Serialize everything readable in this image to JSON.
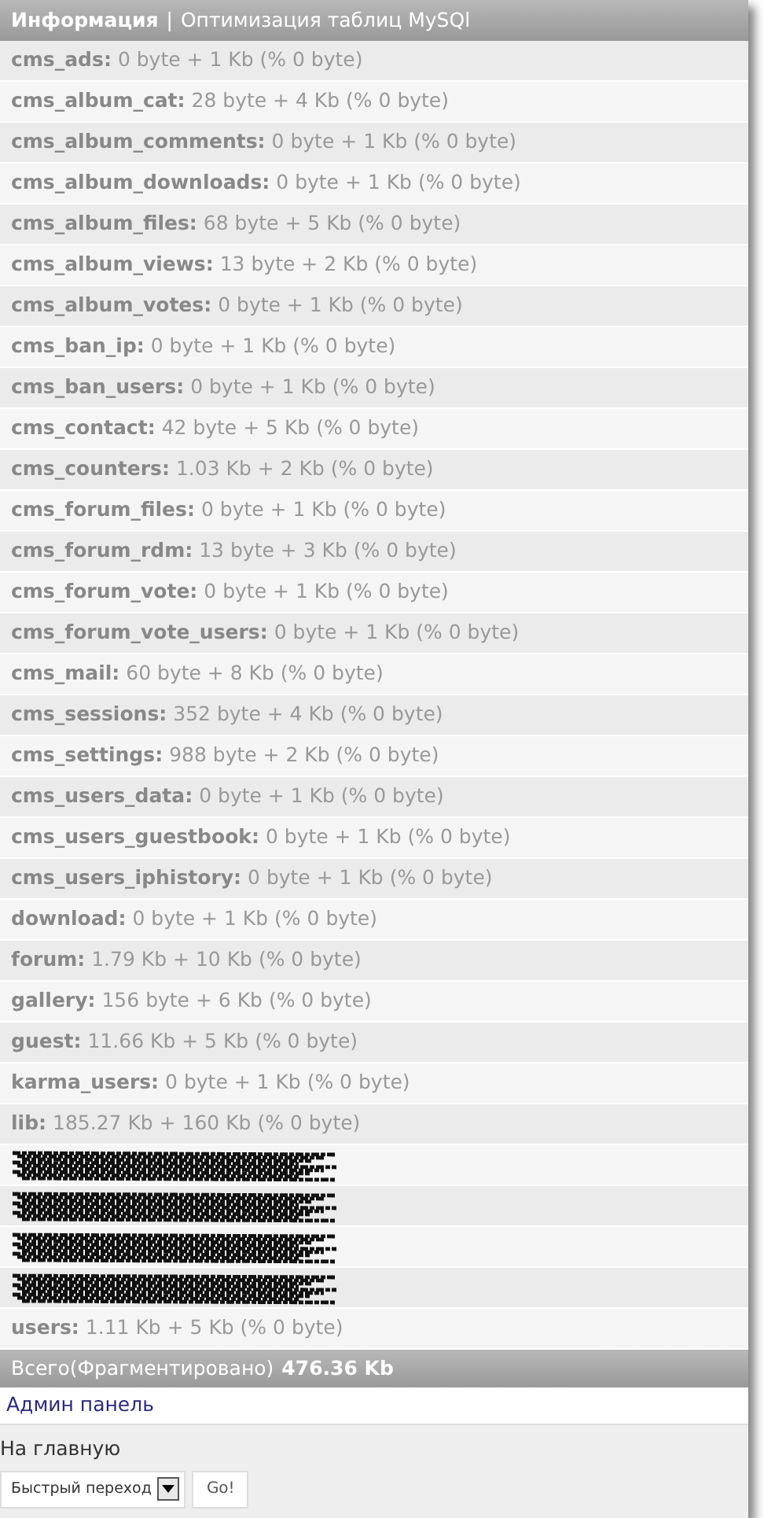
{
  "header": {
    "title": "Информация",
    "separator": "|",
    "subtitle": "Оптимизация таблиц MySQl"
  },
  "rows": [
    {
      "kind": "stat",
      "name": "cms_ads:",
      "value": "0 byte + 1 Kb (% 0 byte)"
    },
    {
      "kind": "stat",
      "name": "cms_album_cat:",
      "value": "28 byte + 4 Kb (% 0 byte)"
    },
    {
      "kind": "stat",
      "name": "cms_album_comments:",
      "value": "0 byte + 1 Kb (% 0 byte)"
    },
    {
      "kind": "stat",
      "name": "cms_album_downloads:",
      "value": "0 byte + 1 Kb (% 0 byte)"
    },
    {
      "kind": "stat",
      "name": "cms_album_files:",
      "value": "68 byte + 5 Kb (% 0 byte)"
    },
    {
      "kind": "stat",
      "name": "cms_album_views:",
      "value": "13 byte + 2 Kb (% 0 byte)"
    },
    {
      "kind": "stat",
      "name": "cms_album_votes:",
      "value": "0 byte + 1 Kb (% 0 byte)"
    },
    {
      "kind": "stat",
      "name": "cms_ban_ip:",
      "value": "0 byte + 1 Kb (% 0 byte)"
    },
    {
      "kind": "stat",
      "name": "cms_ban_users:",
      "value": "0 byte + 1 Kb (% 0 byte)"
    },
    {
      "kind": "stat",
      "name": "cms_contact:",
      "value": "42 byte + 5 Kb (% 0 byte)"
    },
    {
      "kind": "stat",
      "name": "cms_counters:",
      "value": "1.03 Kb + 2 Kb (% 0 byte)"
    },
    {
      "kind": "stat",
      "name": "cms_forum_files:",
      "value": "0 byte + 1 Kb (% 0 byte)"
    },
    {
      "kind": "stat",
      "name": "cms_forum_rdm:",
      "value": "13 byte + 3 Kb (% 0 byte)"
    },
    {
      "kind": "stat",
      "name": "cms_forum_vote:",
      "value": "0 byte + 1 Kb (% 0 byte)"
    },
    {
      "kind": "stat",
      "name": "cms_forum_vote_users:",
      "value": "0 byte + 1 Kb (% 0 byte)"
    },
    {
      "kind": "stat",
      "name": "cms_mail:",
      "value": "60 byte + 8 Kb (% 0 byte)"
    },
    {
      "kind": "stat",
      "name": "cms_sessions:",
      "value": "352 byte + 4 Kb (% 0 byte)"
    },
    {
      "kind": "stat",
      "name": "cms_settings:",
      "value": "988 byte + 2 Kb (% 0 byte)"
    },
    {
      "kind": "stat",
      "name": "cms_users_data:",
      "value": "0 byte + 1 Kb (% 0 byte)"
    },
    {
      "kind": "stat",
      "name": "cms_users_guestbook:",
      "value": "0 byte + 1 Kb (% 0 byte)"
    },
    {
      "kind": "stat",
      "name": "cms_users_iphistory:",
      "value": "0 byte + 1 Kb (% 0 byte)"
    },
    {
      "kind": "stat",
      "name": "download:",
      "value": "0 byte + 1 Kb (% 0 byte)"
    },
    {
      "kind": "stat",
      "name": "forum:",
      "value": "1.79 Kb + 10 Kb (% 0 byte)"
    },
    {
      "kind": "stat",
      "name": "gallery:",
      "value": "156 byte + 6 Kb (% 0 byte)"
    },
    {
      "kind": "stat",
      "name": "guest:",
      "value": "11.66 Kb + 5 Kb (% 0 byte)"
    },
    {
      "kind": "stat",
      "name": "karma_users:",
      "value": "0 byte + 1 Kb (% 0 byte)"
    },
    {
      "kind": "stat",
      "name": "lib:",
      "value": "185.27 Kb + 160 Kb (% 0 byte)"
    },
    {
      "kind": "redacted"
    },
    {
      "kind": "redacted"
    },
    {
      "kind": "redacted"
    },
    {
      "kind": "redacted"
    },
    {
      "kind": "stat",
      "name": "users:",
      "value": "1.11 Kb + 5 Kb (% 0 byte)"
    }
  ],
  "total": {
    "label": "Всего(Фрагментировано)",
    "value": "476.36 Kb"
  },
  "admin_link": "Админ панель",
  "home_link": "На главную",
  "quick_nav": {
    "select": "Быстрый переход",
    "button": "Go!"
  }
}
